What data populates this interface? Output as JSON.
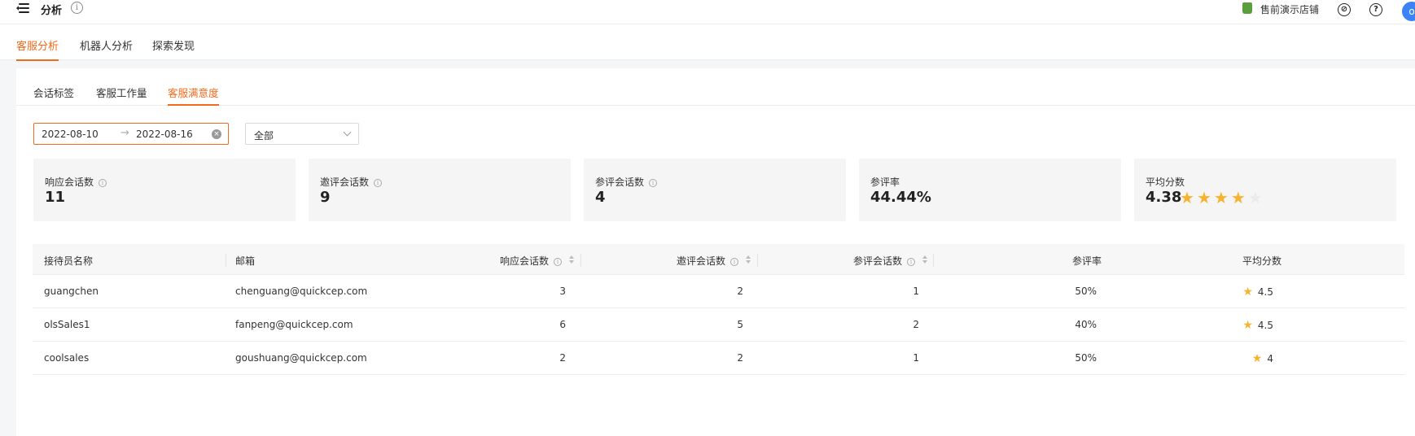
{
  "topbar": {
    "title": "分析",
    "info_icon": "i",
    "shop_name": "售前演示店铺",
    "compass_icon": "⊘",
    "help_icon": "?",
    "avatar_text": "o"
  },
  "main_tabs": [
    {
      "label": "客服分析",
      "active": true
    },
    {
      "label": "机器人分析",
      "active": false
    },
    {
      "label": "探索发现",
      "active": false
    }
  ],
  "sub_tabs": [
    {
      "label": "会话标签",
      "active": false
    },
    {
      "label": "客服工作量",
      "active": false
    },
    {
      "label": "客服满意度",
      "active": true
    }
  ],
  "filters": {
    "date_start": "2022-08-10",
    "date_arrow": "→",
    "date_end": "2022-08-16",
    "clear_icon": "×",
    "select_value": "全部"
  },
  "stats": [
    {
      "label": "响应会话数",
      "value": "11",
      "info": "i"
    },
    {
      "label": "邀评会话数",
      "value": "9",
      "info": "i"
    },
    {
      "label": "参评会话数",
      "value": "4",
      "info": "i"
    },
    {
      "label": "参评率",
      "value": "44.44%"
    },
    {
      "label": "平均分数",
      "value": "4.38",
      "rating_filled": 4,
      "rating_max": 5
    }
  ],
  "table": {
    "headers": [
      "接待员名称",
      "邮箱",
      "响应会话数",
      "邀评会话数",
      "参评会话数",
      "参评率",
      "平均分数"
    ],
    "info": "i",
    "rows": [
      {
        "name": "guangchen",
        "email": "chenguang@quickcep.com",
        "responded": "3",
        "invited": "2",
        "rated": "1",
        "rate": "50%",
        "score": "4.5"
      },
      {
        "name": "olsSales1",
        "email": "fanpeng@quickcep.com",
        "responded": "6",
        "invited": "5",
        "rated": "2",
        "rate": "40%",
        "score": "4.5"
      },
      {
        "name": "coolsales",
        "email": "goushuang@quickcep.com",
        "responded": "2",
        "invited": "2",
        "rated": "1",
        "rate": "50%",
        "score": "4"
      }
    ]
  },
  "colors": {
    "accent": "#f26a1b",
    "star": "#f7b32b",
    "avatar": "#3b82f6"
  }
}
